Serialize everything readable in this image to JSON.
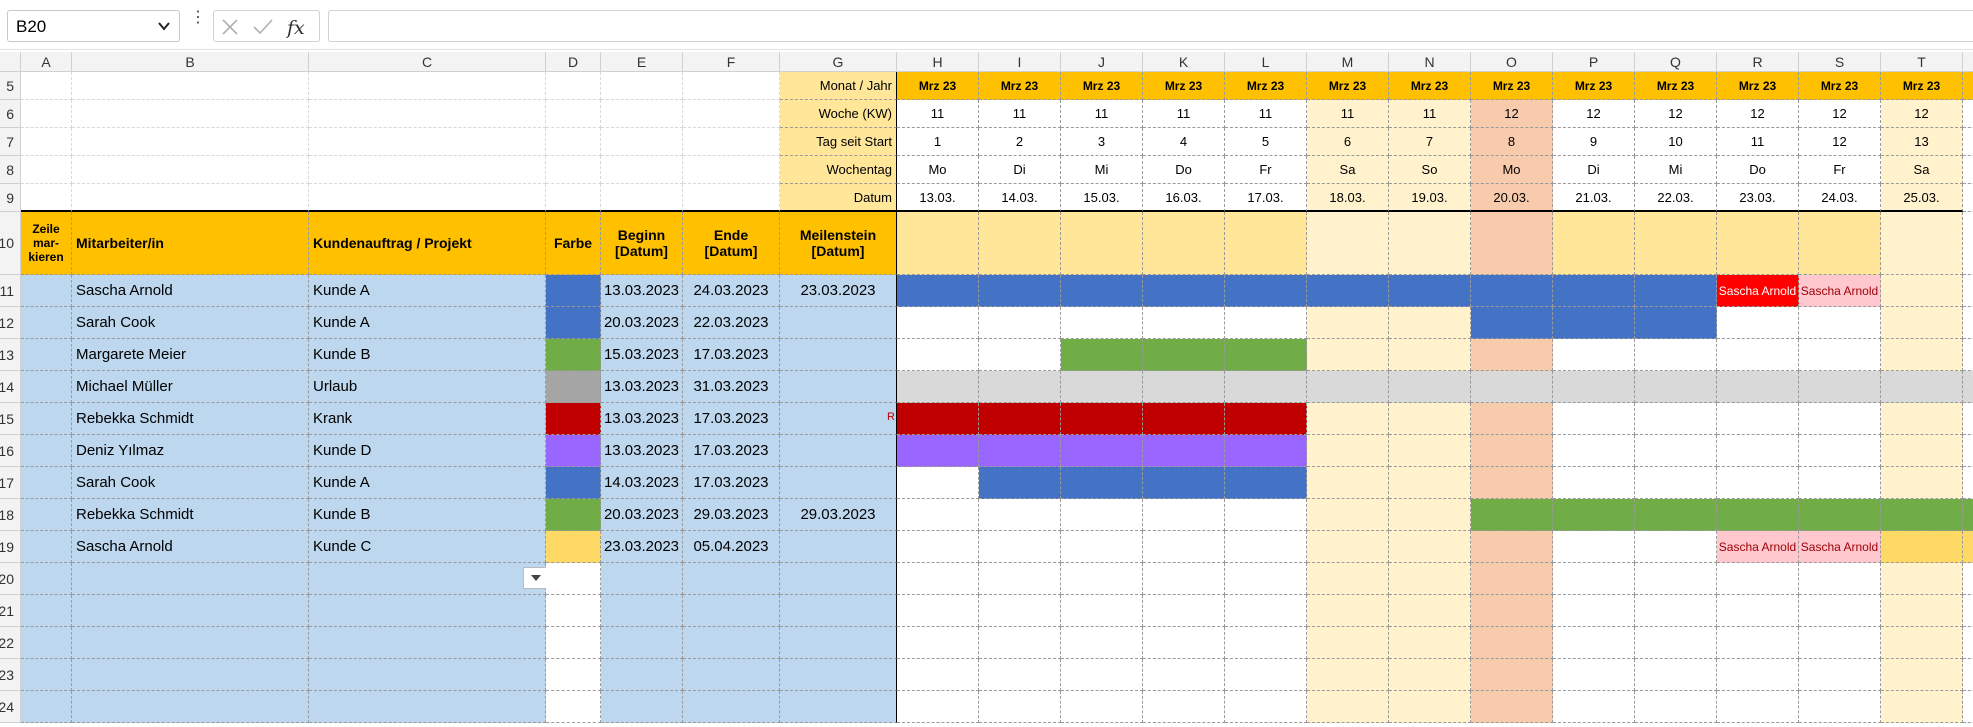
{
  "namebox": "B20",
  "formula_value": "",
  "columns": [
    "A",
    "B",
    "C",
    "D",
    "E",
    "F",
    "G",
    "H",
    "I",
    "J",
    "K",
    "L",
    "M",
    "N",
    "O",
    "P",
    "Q",
    "R",
    "S",
    "T"
  ],
  "row_numbers": [
    "5",
    "6",
    "7",
    "8",
    "9",
    "10",
    "11",
    "12",
    "13",
    "14",
    "15",
    "16",
    "17",
    "18",
    "19",
    "20",
    "21",
    "22",
    "23",
    "24"
  ],
  "timeline_labels": [
    "Monat / Jahr",
    "Woche (KW)",
    "Tag seit Start",
    "Wochentag",
    "Datum"
  ],
  "months": [
    "Mrz 23",
    "Mrz 23",
    "Mrz 23",
    "Mrz 23",
    "Mrz 23",
    "Mrz 23",
    "Mrz 23",
    "Mrz 23",
    "Mrz 23",
    "Mrz 23",
    "Mrz 23",
    "Mrz 23",
    "Mrz 23"
  ],
  "weeks": [
    "11",
    "11",
    "11",
    "11",
    "11",
    "11",
    "11",
    "12",
    "12",
    "12",
    "12",
    "12",
    "12"
  ],
  "day_index": [
    "1",
    "2",
    "3",
    "4",
    "5",
    "6",
    "7",
    "8",
    "9",
    "10",
    "11",
    "12",
    "13"
  ],
  "weekdays": [
    "Mo",
    "Di",
    "Mi",
    "Do",
    "Fr",
    "Sa",
    "So",
    "Mo",
    "Di",
    "Mi",
    "Do",
    "Fr",
    "Sa"
  ],
  "dates": [
    "13.03.",
    "14.03.",
    "15.03.",
    "16.03.",
    "17.03.",
    "18.03.",
    "19.03.",
    "20.03.",
    "21.03.",
    "22.03.",
    "23.03.",
    "24.03.",
    "25.03."
  ],
  "headers": {
    "mark": [
      "Zeile",
      "mar-",
      "kieren"
    ],
    "employee": "Mitarbeiter/in",
    "project": "Kundenauftrag / Projekt",
    "color": "Farbe",
    "begin": [
      "Beginn",
      "[Datum]"
    ],
    "end": [
      "Ende",
      "[Datum]"
    ],
    "milestone": [
      "Meilenstein",
      "[Datum]"
    ]
  },
  "rows": [
    {
      "employee": "Sascha Arnold",
      "project": "Kunde A",
      "color": "#4472c4",
      "begin": "13.03.2023",
      "end": "24.03.2023",
      "milestone": "23.03.2023"
    },
    {
      "employee": "Sarah Cook",
      "project": "Kunde A",
      "color": "#4472c4",
      "begin": "20.03.2023",
      "end": "22.03.2023",
      "milestone": ""
    },
    {
      "employee": "Margarete Meier",
      "project": "Kunde B",
      "color": "#70ad47",
      "begin": "15.03.2023",
      "end": "17.03.2023",
      "milestone": ""
    },
    {
      "employee": "Michael Müller",
      "project": "Urlaub",
      "color": "#a5a5a5",
      "begin": "13.03.2023",
      "end": "31.03.2023",
      "milestone": ""
    },
    {
      "employee": "Rebekka Schmidt",
      "project": "Krank",
      "color": "#c00000",
      "begin": "13.03.2023",
      "end": "17.03.2023",
      "milestone": "",
      "overflow": "R"
    },
    {
      "employee": "Deniz Yılmaz",
      "project": "Kunde D",
      "color": "#9966ff",
      "begin": "13.03.2023",
      "end": "17.03.2023",
      "milestone": ""
    },
    {
      "employee": "Sarah Cook",
      "project": "Kunde A",
      "color": "#4472c4",
      "begin": "14.03.2023",
      "end": "17.03.2023",
      "milestone": ""
    },
    {
      "employee": "Rebekka Schmidt",
      "project": "Kunde B",
      "color": "#70ad47",
      "begin": "20.03.2023",
      "end": "29.03.2023",
      "milestone": "29.03.2023"
    },
    {
      "employee": "Sascha Arnold",
      "project": "Kunde C",
      "color": "#ffd966",
      "begin": "23.03.2023",
      "end": "05.04.2023",
      "milestone": ""
    }
  ],
  "conflict_labels": [
    {
      "row": 0,
      "day": 10,
      "text": "Sascha Arnold",
      "style": "strong"
    },
    {
      "row": 0,
      "day": 11,
      "text": "Sascha Arnold",
      "style": "light"
    },
    {
      "row": 8,
      "day": 10,
      "text": "Sascha Arnold",
      "style": "light"
    },
    {
      "row": 8,
      "day": 11,
      "text": "Sascha Arnold",
      "style": "light"
    }
  ],
  "colors": {
    "header_orange": "#ffc000",
    "header_light": "#ffe699",
    "weekend": "#fff2cc",
    "today": "#f8cbad",
    "input_blue": "#bdd7ee",
    "vacation": "#d9d9d9",
    "conflict_strong": "#ff0000",
    "conflict_light": "#ffc7ce",
    "conflict_text": "#9c0006"
  }
}
